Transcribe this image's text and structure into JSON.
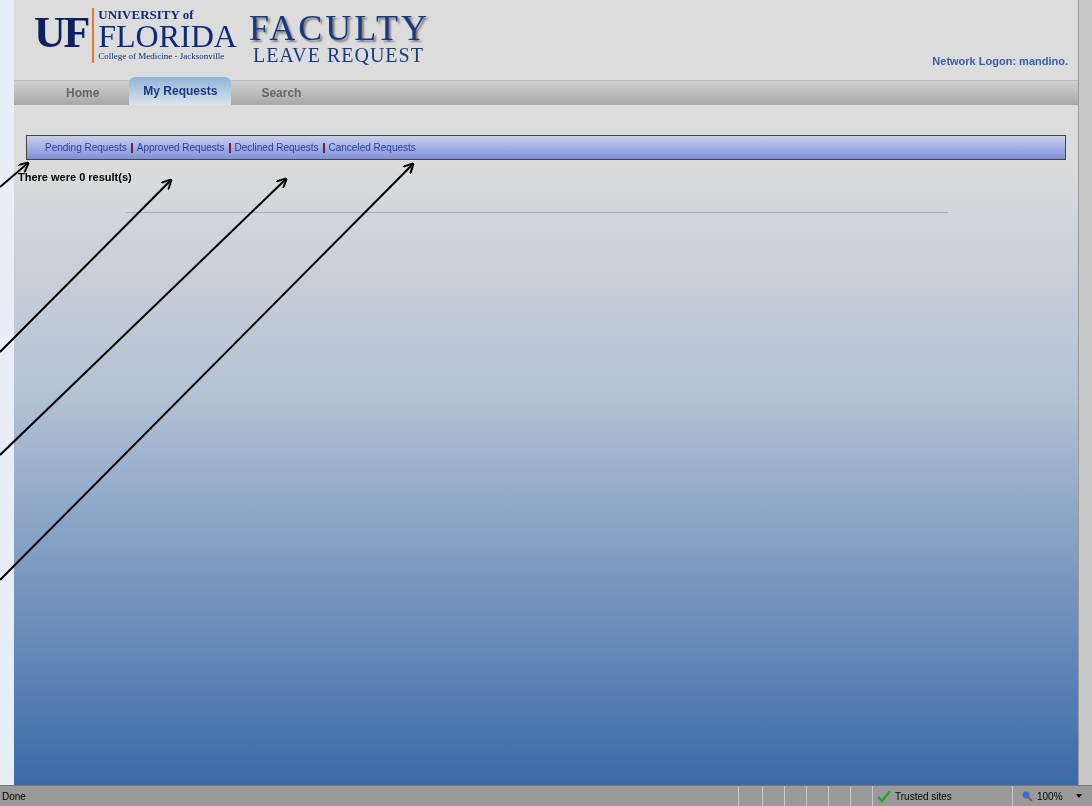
{
  "logo": {
    "mark": "UF",
    "university": "UNIVERSITY of",
    "name": "FLORIDA",
    "college": "College of Medicine - Jacksonville"
  },
  "title": {
    "main": "FACULTY",
    "sub": "LEAVE REQUEST"
  },
  "network_logon": "Network Logon: mandino.",
  "tabs": [
    {
      "label": "Home",
      "selected": false
    },
    {
      "label": "My Requests",
      "selected": true
    },
    {
      "label": "Search",
      "selected": false
    }
  ],
  "sub_links": [
    "Pending Requests",
    "Approved Requests",
    "Declined Requests",
    "Canceled Requests"
  ],
  "results": "There were 0 result(s)",
  "status_bar": {
    "text": "Done",
    "zone": "Trusted sites",
    "zoom": "100%"
  }
}
